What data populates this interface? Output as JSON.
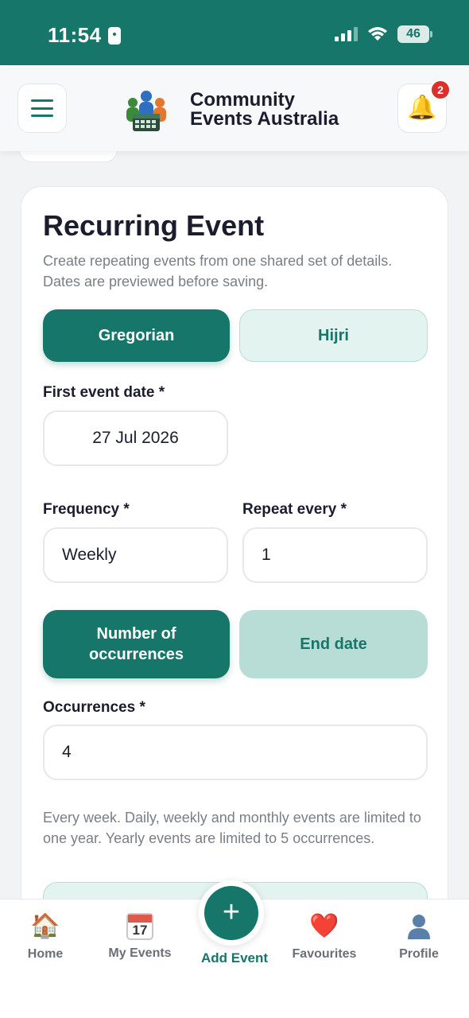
{
  "status_bar": {
    "time": "11:54",
    "battery": "46"
  },
  "header": {
    "title_line1": "Community",
    "title_line2": "Events Australia",
    "notification_count": "2"
  },
  "form": {
    "title": "Recurring Event",
    "description": "Create repeating events from one shared set of details. Dates are previewed before saving.",
    "calendar_toggle": {
      "gregorian": "Gregorian",
      "hijri": "Hijri",
      "selected": "Gregorian"
    },
    "first_date_label": "First event date *",
    "first_date_value": "27 Jul 2026",
    "frequency_label": "Frequency *",
    "frequency_value": "Weekly",
    "repeat_every_label": "Repeat every *",
    "repeat_every_value": "1",
    "end_mode": {
      "occurrences": "Number of occurrences",
      "end_date": "End date",
      "selected": "Number of occurrences"
    },
    "occurrences_label": "Occurrences *",
    "occurrences_value": "4",
    "helper_text": "Every week. Daily, weekly and monthly events are limited to one year. Yearly events are limited to 5 occurrences."
  },
  "bottom_nav": {
    "home": "Home",
    "my_events": "My Events",
    "my_events_icon_day": "17",
    "add_event": "Add Event",
    "favourites": "Favourites",
    "profile": "Profile"
  },
  "colors": {
    "brand": "#157669",
    "brand_light": "#e3f3f0",
    "badge_red": "#d9302b"
  }
}
